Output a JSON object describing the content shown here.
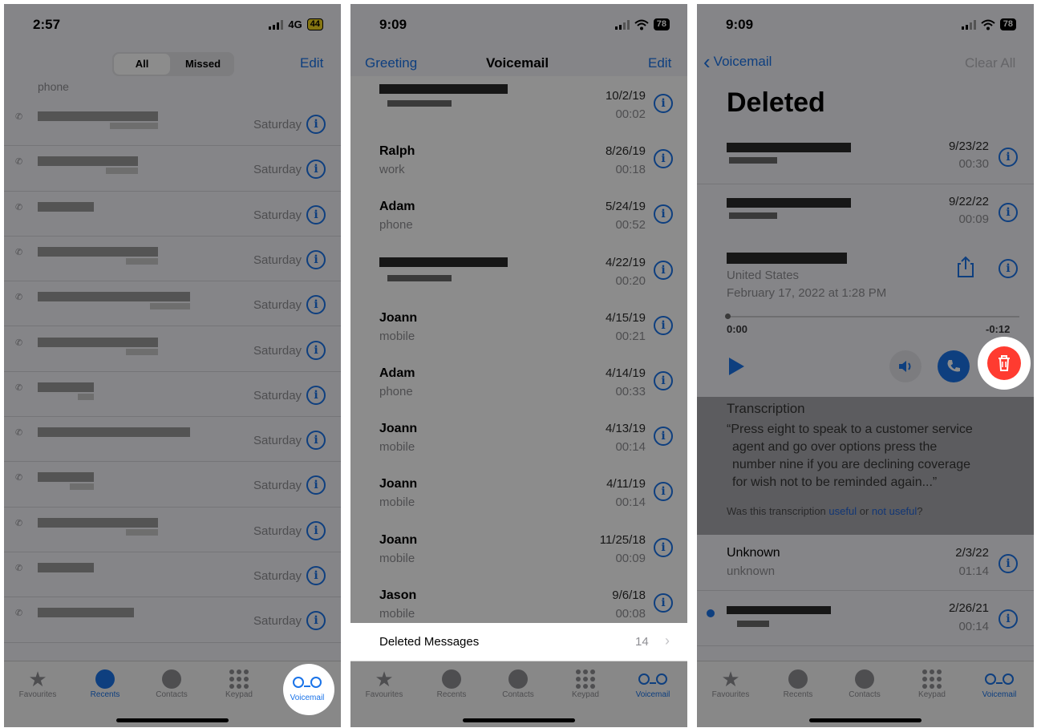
{
  "panel1": {
    "status": {
      "time": "2:57",
      "network": "4G",
      "battery": "44"
    },
    "segment": {
      "all": "All",
      "missed": "Missed"
    },
    "edit": "Edit",
    "first_row_sub": "phone",
    "row_label": "Saturday",
    "rows": 13
  },
  "panel2": {
    "status": {
      "time": "9:09",
      "battery": "78"
    },
    "greeting": "Greeting",
    "title": "Voicemail",
    "edit": "Edit",
    "rows": [
      {
        "name": "",
        "sub": "",
        "date": "10/2/19",
        "dur": "00:02"
      },
      {
        "name": "Ralph",
        "sub": "work",
        "date": "8/26/19",
        "dur": "00:18"
      },
      {
        "name": "Adam",
        "sub": "phone",
        "date": "5/24/19",
        "dur": "00:52"
      },
      {
        "name": "",
        "sub": "",
        "date": "4/22/19",
        "dur": "00:20"
      },
      {
        "name": "Joann",
        "sub": "mobile",
        "date": "4/15/19",
        "dur": "00:21"
      },
      {
        "name": "Adam",
        "sub": "phone",
        "date": "4/14/19",
        "dur": "00:33"
      },
      {
        "name": "Joann",
        "sub": "mobile",
        "date": "4/13/19",
        "dur": "00:14"
      },
      {
        "name": "Joann",
        "sub": "mobile",
        "date": "4/11/19",
        "dur": "00:14"
      },
      {
        "name": "Joann",
        "sub": "mobile",
        "date": "11/25/18",
        "dur": "00:09"
      },
      {
        "name": "Jason",
        "sub": "mobile",
        "date": "9/6/18",
        "dur": "00:08"
      }
    ],
    "deleted": {
      "label": "Deleted Messages",
      "count": "14"
    }
  },
  "panel3": {
    "status": {
      "time": "9:09",
      "battery": "78"
    },
    "back": "Voicemail",
    "clear_all": "Clear All",
    "title": "Deleted",
    "rows_top": [
      {
        "date": "9/23/22",
        "dur": "00:30"
      },
      {
        "date": "9/22/22",
        "dur": "00:09"
      }
    ],
    "expanded": {
      "location": "United States",
      "datetime": "February 17, 2022 at 1:28 PM",
      "elapsed": "0:00",
      "remaining": "-0:12",
      "transcription_heading": "Transcription",
      "transcription_lines": [
        "“Press eight to speak to a customer service",
        "agent and go over options press the",
        "number nine if you are declining coverage",
        "for wish not to be reminded again...”"
      ],
      "feedback_prefix": "Was this transcription ",
      "useful": "useful",
      "or": " or ",
      "not_useful": "not useful",
      "qmark": "?"
    },
    "rows_bottom": [
      {
        "name": "Unknown",
        "sub": "unknown",
        "date": "2/3/22",
        "dur": "01:14"
      },
      {
        "name": "",
        "sub": "",
        "date": "2/26/21",
        "dur": "00:14"
      }
    ]
  },
  "tabs": {
    "favourites": "Favourites",
    "recents": "Recents",
    "contacts": "Contacts",
    "keypad": "Keypad",
    "voicemail": "Voicemail"
  },
  "colors": {
    "accent": "#1a73e8",
    "delete": "#ff3b30"
  }
}
